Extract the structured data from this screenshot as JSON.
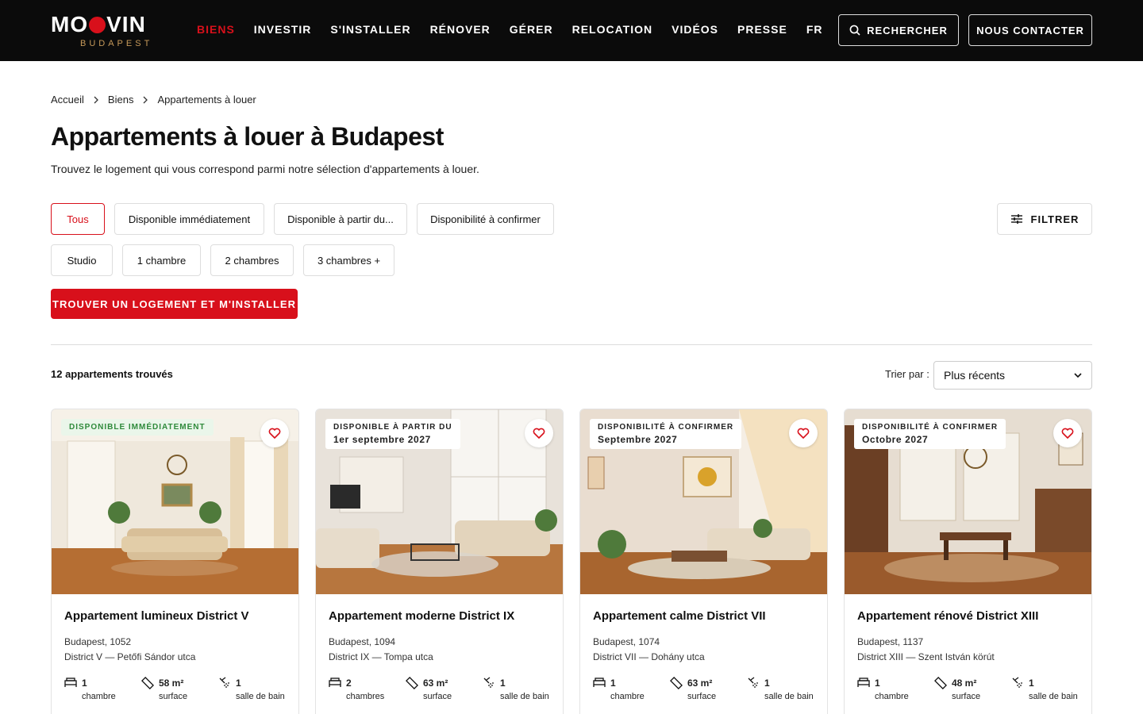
{
  "brand": {
    "name_pre": "M",
    "name_post": "VIN",
    "city": "BUDAPEST",
    "colors": {
      "accent": "#d8101b",
      "gold": "#c79a5a"
    }
  },
  "nav": [
    "BIENS",
    "INVESTIR",
    "S'INSTALLER",
    "RÉNOVER",
    "GÉRER",
    "RELOCATION",
    "VIDÉOS",
    "PRESSE",
    "FR"
  ],
  "header": {
    "search_label": "RECHERCHER",
    "contact_label": "NOUS CONTACTER"
  },
  "breadcrumb": [
    "Accueil",
    "Biens",
    "Appartements à louer"
  ],
  "page": {
    "title": "Appartements à louer à Budapest",
    "subtitle": "Trouvez le logement qui vous correspond parmi notre sélection d'appartements à louer."
  },
  "filters": {
    "availability": [
      "Tous",
      "Disponible immédiatement",
      "Disponible à partir du...",
      "Disponibilité à confirmer"
    ],
    "rooms": [
      "Studio",
      "1 chambre",
      "2 chambres",
      "3 chambres +"
    ],
    "filter_label": "FILTRER",
    "cta_label": "TROUVER UN LOGEMENT ET M'INSTALLER"
  },
  "results": {
    "count_label": "12 appartements trouvés",
    "sort_label": "Trier par :",
    "sort_value": "Plus récents"
  },
  "cards": [
    {
      "badge": "DISPONIBLE IMMÉDIATEMENT",
      "badge_date": "",
      "title": "Appartement lumineux District V",
      "city": "Budapest, 1052",
      "street": "District V — Petőfi Sándor utca",
      "rooms_val": "1",
      "rooms_lbl": "chambre",
      "surface_val": "58 m²",
      "surface_lbl": "surface",
      "bath_val": "1",
      "bath_lbl": "salle de bain"
    },
    {
      "badge": "DISPONIBLE À PARTIR DU",
      "badge_date": "1er septembre 2027",
      "title": "Appartement moderne District IX",
      "city": "Budapest, 1094",
      "street": "District IX — Tompa utca",
      "rooms_val": "2",
      "rooms_lbl": "chambres",
      "surface_val": "63 m²",
      "surface_lbl": "surface",
      "bath_val": "1",
      "bath_lbl": "salle de bain"
    },
    {
      "badge": "DISPONIBILITÉ À CONFIRMER",
      "badge_date": "Septembre 2027",
      "title": "Appartement calme District VII",
      "city": "Budapest, 1074",
      "street": "District VII — Dohány utca",
      "rooms_val": "1",
      "rooms_lbl": "chambre",
      "surface_val": "63 m²",
      "surface_lbl": "surface",
      "bath_val": "1",
      "bath_lbl": "salle de bain"
    },
    {
      "badge": "DISPONIBILITÉ À CONFIRMER",
      "badge_date": "Octobre 2027",
      "title": "Appartement rénové District XIII",
      "city": "Budapest, 1137",
      "street": "District XIII — Szent István körút",
      "rooms_val": "1",
      "rooms_lbl": "chambre",
      "surface_val": "48 m²",
      "surface_lbl": "surface",
      "bath_val": "1",
      "bath_lbl": "salle de bain"
    }
  ]
}
